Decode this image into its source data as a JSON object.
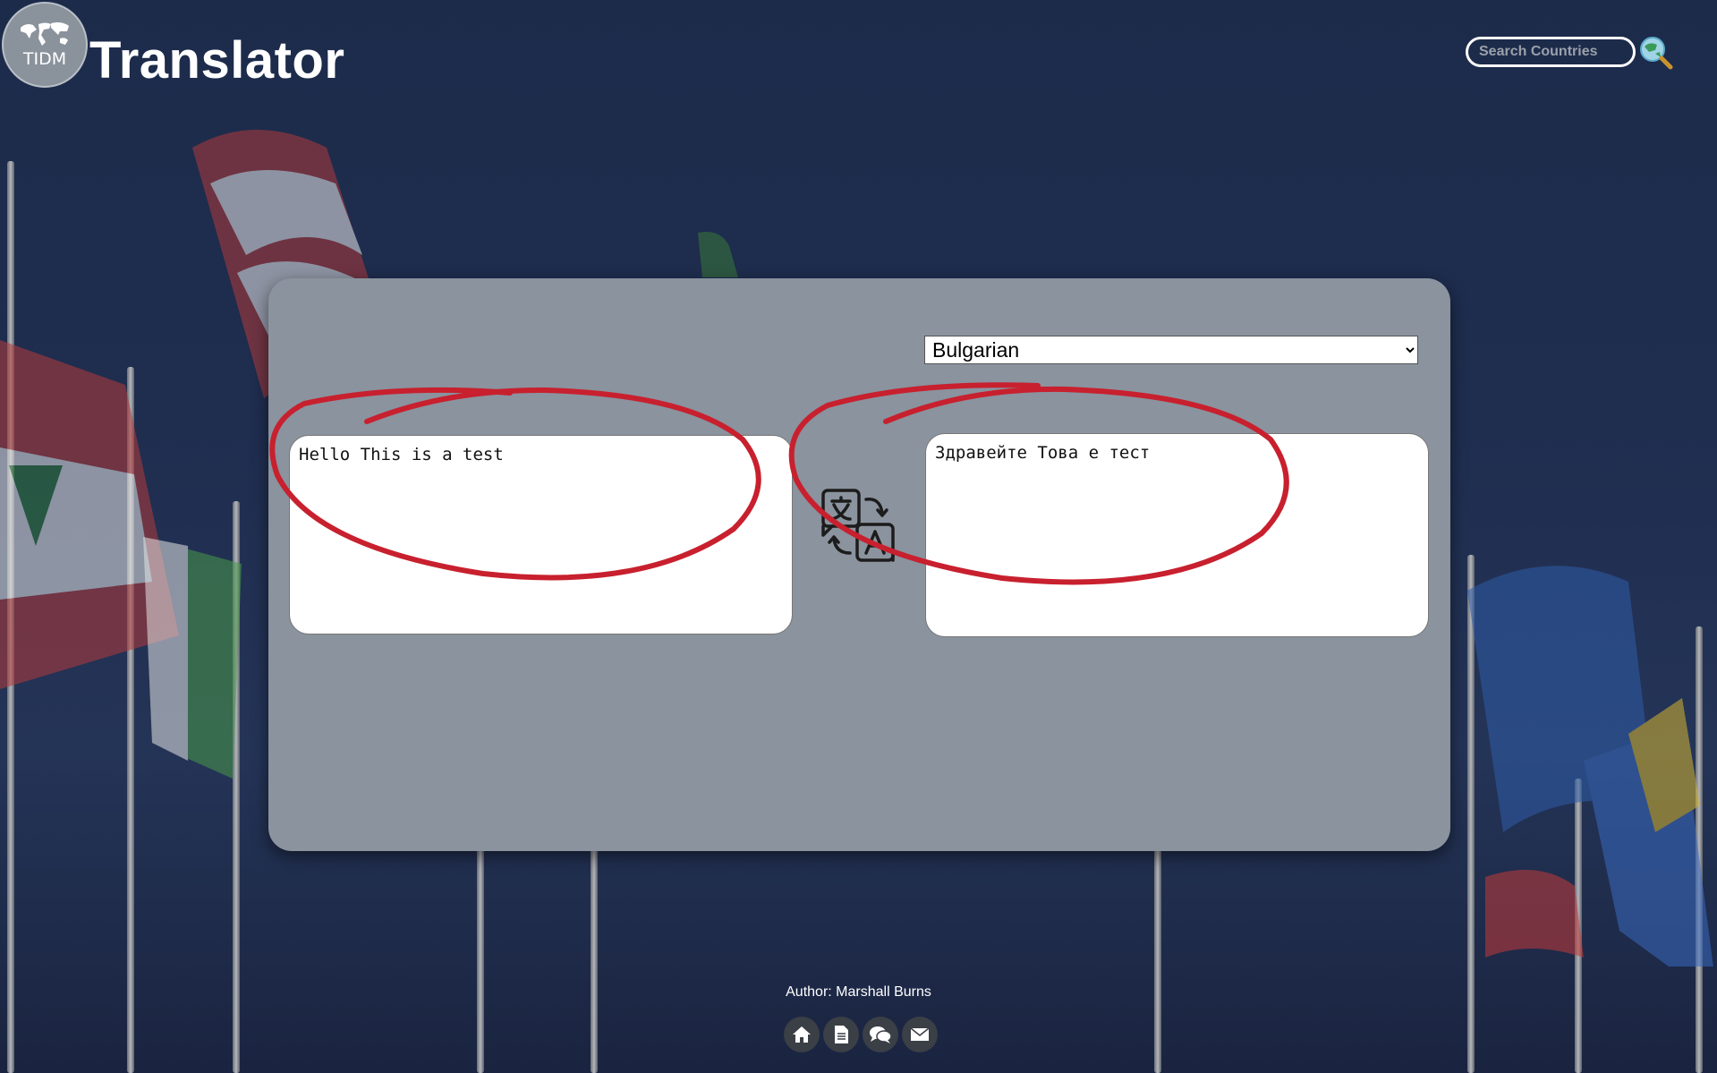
{
  "header": {
    "logo_text": "TIDM",
    "title": "Translator",
    "search": {
      "placeholder": "Search Countries",
      "value": ""
    }
  },
  "translator": {
    "target_language": "Bulgarian",
    "languages": [
      "Bulgarian"
    ],
    "source_text": "Hello This is a test",
    "translated_text": "Здравейте Това е тест"
  },
  "footer": {
    "author": "Author: Marshall Burns",
    "icons": [
      "home-icon",
      "document-icon",
      "chat-icon",
      "mail-icon"
    ]
  },
  "colors": {
    "background": "#1d2b4b",
    "panel": "#8a939e",
    "annotation_red": "#c8202e"
  }
}
